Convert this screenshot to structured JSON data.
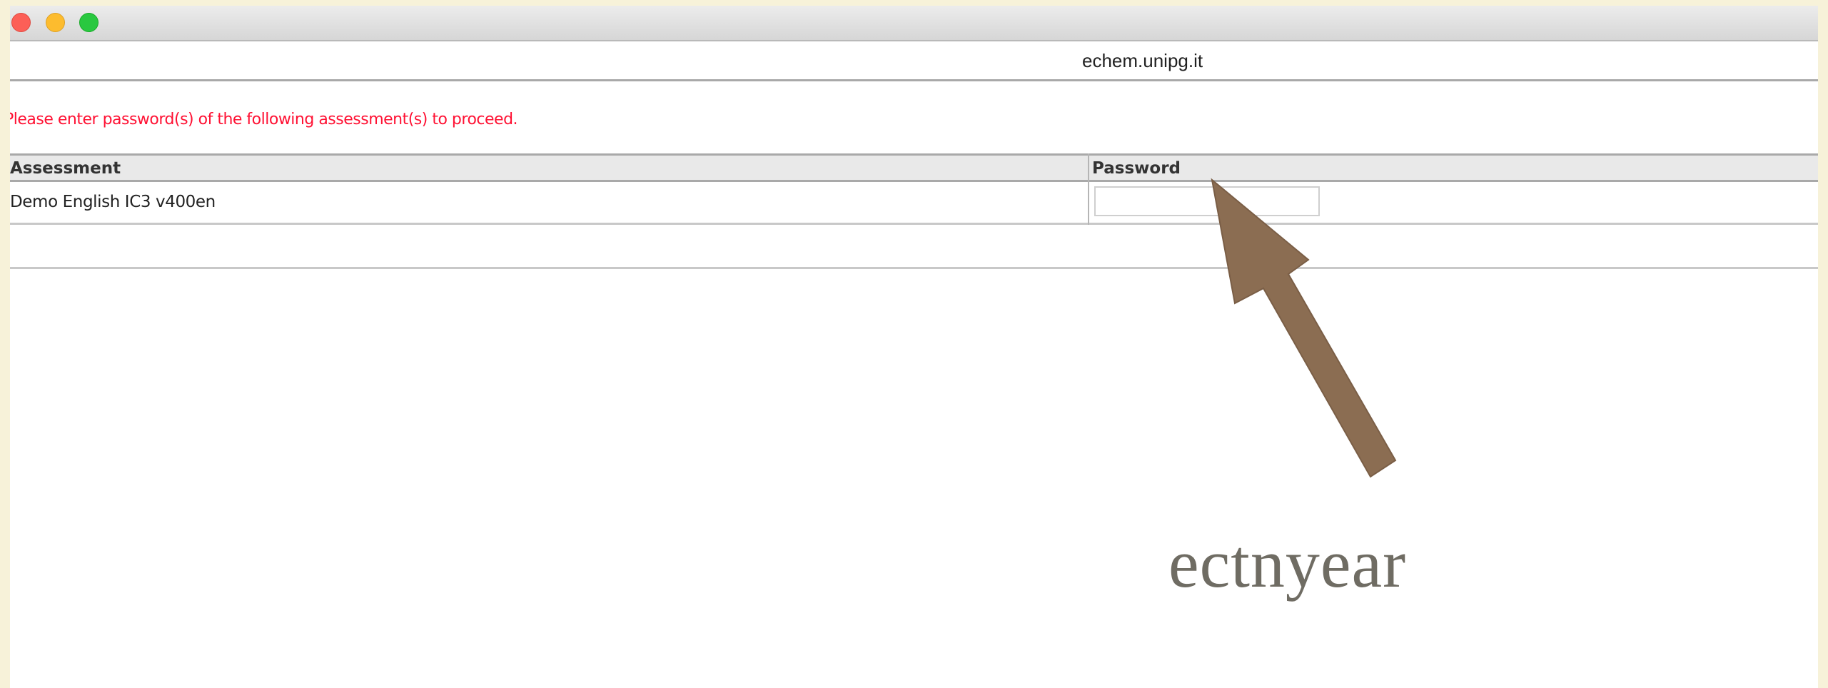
{
  "window": {
    "controls": {
      "close_icon": "close-traffic-light",
      "minimize_icon": "minimize-traffic-light",
      "maximize_icon": "maximize-traffic-light"
    },
    "host": "echem.unipg.it"
  },
  "page": {
    "notice": "Please enter password(s) of the following assessment(s) to proceed.",
    "table": {
      "headers": {
        "assessment": "Assessment",
        "password": "Password"
      },
      "rows": [
        {
          "assessment": "Demo English IC3 v400en",
          "password_value": ""
        }
      ]
    }
  },
  "annotation": {
    "arrow_icon": "arrow-up-left-icon",
    "text": "ectnyear",
    "color": "#8b6d52"
  },
  "colors": {
    "notice": "#ff1133",
    "background": "#f7f2d9"
  }
}
